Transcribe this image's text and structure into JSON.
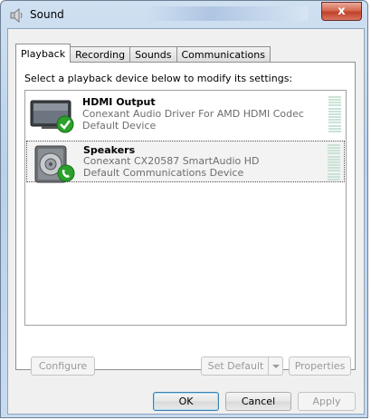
{
  "window": {
    "title": "Sound",
    "close_label": "x"
  },
  "tabs": [
    {
      "label": "Playback",
      "active": true
    },
    {
      "label": "Recording",
      "active": false
    },
    {
      "label": "Sounds",
      "active": false
    },
    {
      "label": "Communications",
      "active": false
    }
  ],
  "instruction": "Select a playback device below to modify its settings:",
  "devices": [
    {
      "name": "HDMI Output",
      "driver": "Conexant Audio Driver For AMD HDMI Codec",
      "status": "Default Device",
      "icon": "monitor-icon",
      "badge": "check-icon",
      "selected": false
    },
    {
      "name": "Speakers",
      "driver": "Conexant CX20587 SmartAudio HD",
      "status": "Default Communications Device",
      "icon": "speaker-icon",
      "badge": "phone-icon",
      "selected": true
    }
  ],
  "buttons": {
    "configure": "Configure",
    "set_default": "Set Default",
    "properties": "Properties",
    "ok": "OK",
    "cancel": "Cancel",
    "apply": "Apply"
  },
  "colors": {
    "accent": "#3c7fb1",
    "badge_green": "#2aa12a",
    "level_meter": "#c9e3d6"
  }
}
